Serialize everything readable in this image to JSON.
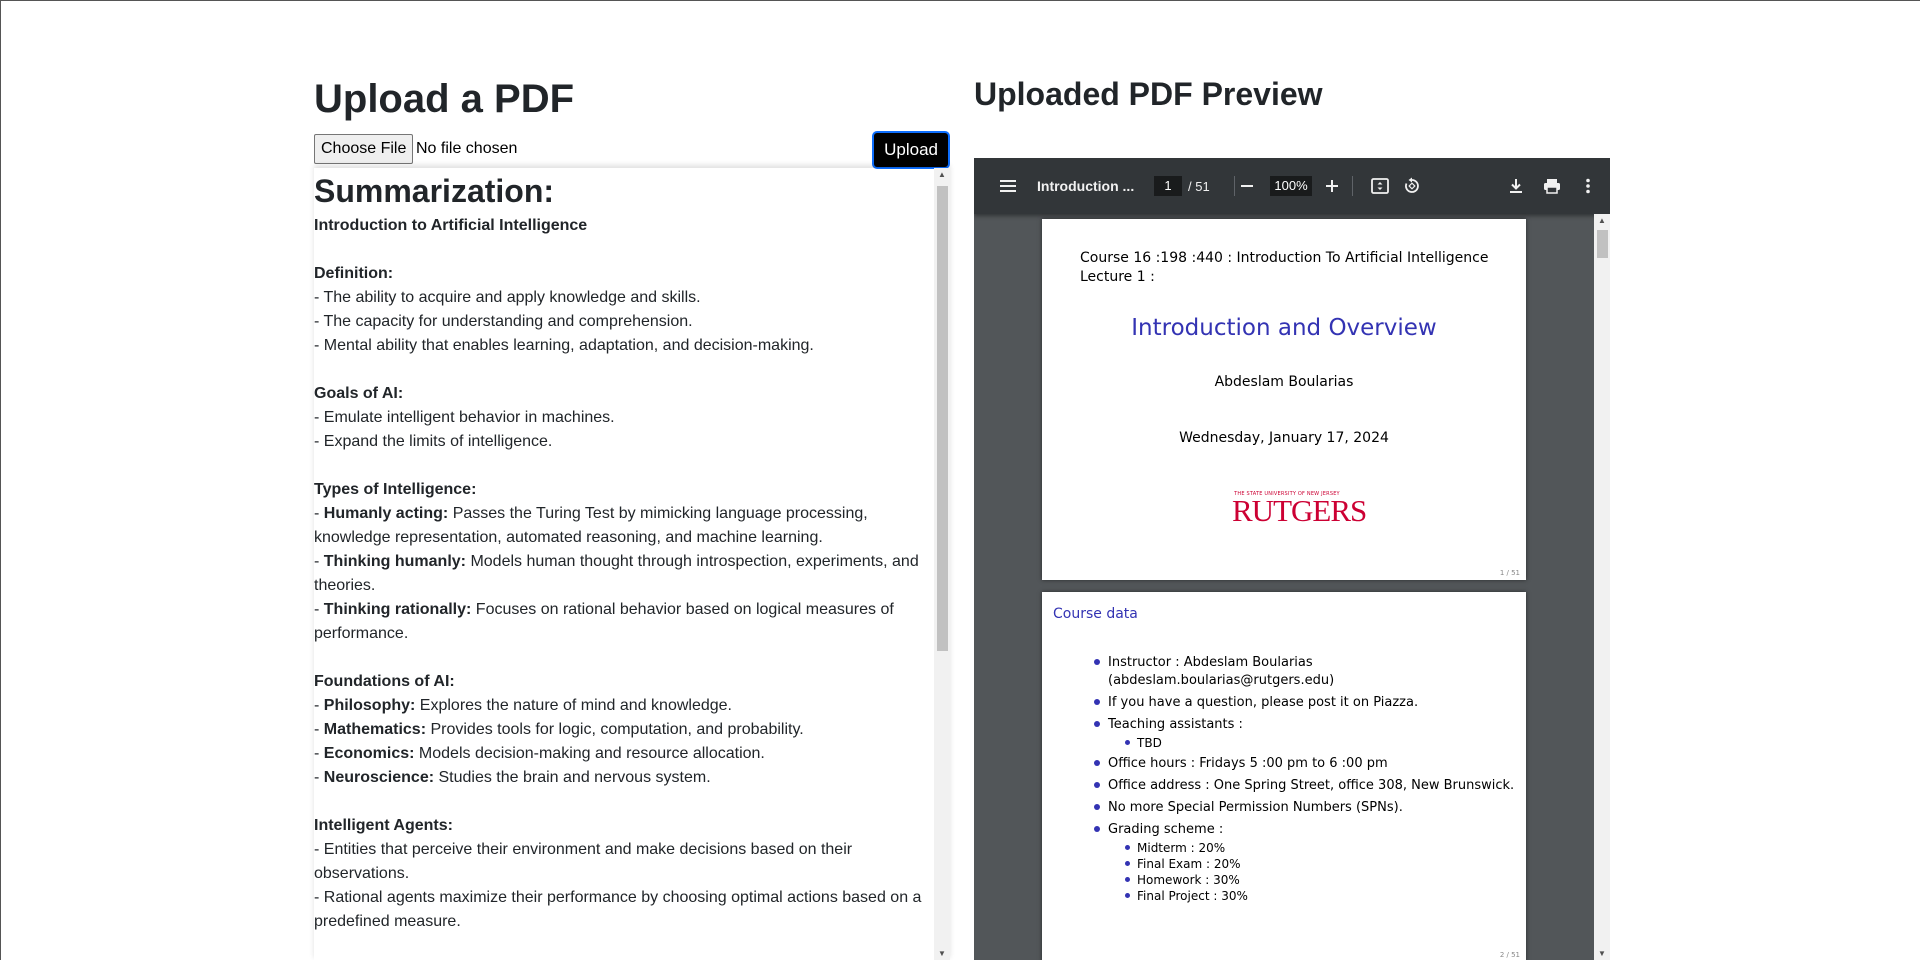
{
  "upload": {
    "title": "Upload a PDF",
    "choose_file_label": "Choose File",
    "file_status": "No file chosen",
    "upload_button": "Upload"
  },
  "summary": {
    "heading": "Summarization:",
    "topic": "Introduction to Artificial Intelligence",
    "sections": [
      {
        "title": "Definition:",
        "items": [
          {
            "bold": "",
            "text": "The ability to acquire and apply knowledge and skills."
          },
          {
            "bold": "",
            "text": "The capacity for understanding and comprehension."
          },
          {
            "bold": "",
            "text": "Mental ability that enables learning, adaptation, and decision-making."
          }
        ]
      },
      {
        "title": "Goals of AI:",
        "items": [
          {
            "bold": "",
            "text": "Emulate intelligent behavior in machines."
          },
          {
            "bold": "",
            "text": "Expand the limits of intelligence."
          }
        ]
      },
      {
        "title": "Types of Intelligence:",
        "items": [
          {
            "bold": "Humanly acting:",
            "text": " Passes the Turing Test by mimicking language processing, knowledge representation, automated reasoning, and machine learning."
          },
          {
            "bold": "Thinking humanly:",
            "text": " Models human thought through introspection, experiments, and theories."
          },
          {
            "bold": "Thinking rationally:",
            "text": " Focuses on rational behavior based on logical measures of performance."
          }
        ]
      },
      {
        "title": "Foundations of AI:",
        "items": [
          {
            "bold": "Philosophy:",
            "text": " Explores the nature of mind and knowledge."
          },
          {
            "bold": "Mathematics:",
            "text": " Provides tools for logic, computation, and probability."
          },
          {
            "bold": "Economics:",
            "text": " Models decision-making and resource allocation."
          },
          {
            "bold": "Neuroscience:",
            "text": " Studies the brain and nervous system."
          }
        ]
      },
      {
        "title": "Intelligent Agents:",
        "items": [
          {
            "bold": "",
            "text": "Entities that perceive their environment and make decisions based on their observations."
          },
          {
            "bold": "",
            "text": "Rational agents maximize their performance by choosing optimal actions based on a predefined measure."
          }
        ]
      }
    ]
  },
  "preview": {
    "title": "Uploaded PDF Preview",
    "toolbar": {
      "doc_title": "Introduction ...",
      "current_page": "1",
      "total_pages": "/ 51",
      "zoom": "100%"
    },
    "page1": {
      "course_line1": "Course 16 :198 :440 : Introduction To Artificial Intelligence",
      "course_line2": "Lecture 1 :",
      "title": "Introduction and Overview",
      "author": "Abdeslam Boularias",
      "date": "Wednesday, January 17, 2024",
      "logo_small": "THE STATE UNIVERSITY OF NEW JERSEY",
      "logo_big": "RUTGERS",
      "page_number": "1 / 51"
    },
    "page2": {
      "heading": "Course data",
      "items": [
        {
          "text": "Instructor : Abdeslam Boularias (abdeslam.boularias@rutgers.edu)",
          "subs": []
        },
        {
          "text": "If you have a question, please post it on Piazza.",
          "subs": []
        },
        {
          "text": "Teaching assistants :",
          "subs": [
            "TBD"
          ]
        },
        {
          "text": "Office hours : Fridays 5 :00 pm to 6 :00 pm",
          "subs": []
        },
        {
          "text": "Office address : One Spring Street, office 308, New Brunswick.",
          "subs": []
        },
        {
          "text": "No more Special Permission Numbers (SPNs).",
          "subs": []
        },
        {
          "text": "Grading scheme :",
          "subs": [
            "Midterm : 20%",
            "Final Exam : 20%",
            "Homework : 30%",
            "Final Project : 30%"
          ]
        }
      ],
      "page_number": "2 / 51"
    }
  },
  "colors": {
    "upload_button_bg": "#000000",
    "upload_button_border": "#0d6efd",
    "pdf_toolbar": "#323639",
    "pdf_background": "#525659",
    "beamer_blue": "#3333b3",
    "rutgers_red": "#cc0033"
  }
}
